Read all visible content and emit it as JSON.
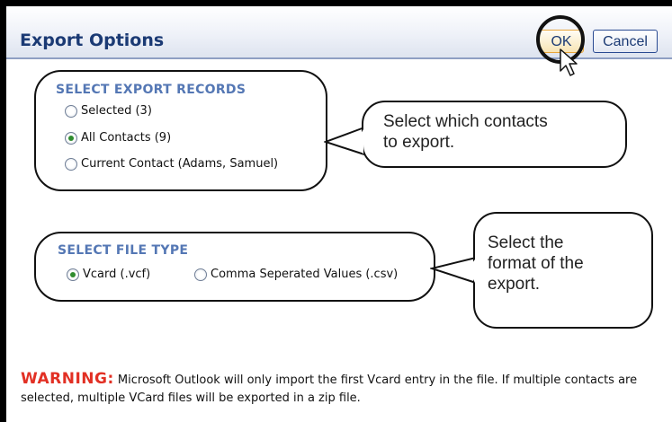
{
  "header": {
    "title": "Export Options",
    "ok_label": "OK",
    "cancel_label": "Cancel"
  },
  "export_records": {
    "title": "SELECT EXPORT RECORDS",
    "options": [
      "Selected (3)",
      "All Contacts (9)",
      "Current Contact (Adams, Samuel)"
    ],
    "selected": "All Contacts (9)"
  },
  "callout_records": {
    "line1": "Select which contacts",
    "line2": "to export."
  },
  "file_type": {
    "title": "SELECT FILE TYPE",
    "options": [
      "Vcard (.vcf)",
      "Comma Seperated Values (.csv)"
    ],
    "selected": "Vcard (.vcf)"
  },
  "callout_format": {
    "line1": "Select the",
    "line2": "format of the",
    "line3": "export."
  },
  "warning": {
    "label": "WARNING:",
    "text": "Microsoft Outlook will only import the first Vcard entry in the file. If multiple contacts are selected, multiple VCard files will be exported in a zip file."
  }
}
